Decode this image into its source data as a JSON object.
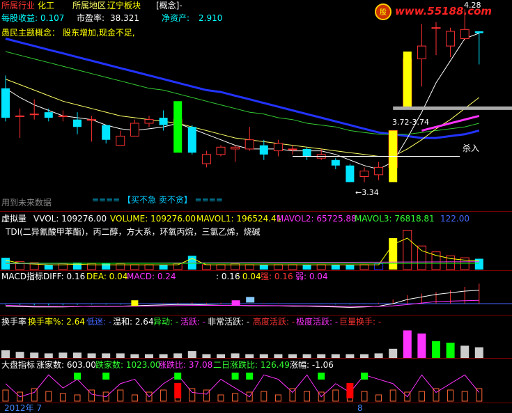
{
  "header": {
    "industry_label": "所属行业",
    "industry_value": "化工",
    "region_label": "所属地区",
    "region_value": "辽宁板块",
    "concept_label": "[概念]-",
    "eps_label": "每股收益:",
    "eps_value": "0.107",
    "pe_label": "市盈率:",
    "pe_value": "38.321",
    "nav_label": "净资产:",
    "nav_value": "2.910",
    "theme_label": "愚民主题概念：",
    "theme_value": "股东增加,现金不足,",
    "future_label": "用到未来数据",
    "advice": "==== 【买不急  卖不贪】 ===="
  },
  "watermark": {
    "site": "www.55188.com"
  },
  "colors": {
    "up": "#ff3232",
    "down": "#00e5ff",
    "ma5": "#ffffff",
    "ma10": "#ffff66",
    "ma20": "#33cc33",
    "ma60": "#2233ff",
    "magenta": "#ff33ff",
    "yellow": "#ffff00",
    "green": "#00ff00",
    "cyan": "#00e5ff",
    "red": "#ff0000",
    "gray": "#aaaaaa"
  },
  "price_panel": {
    "high_label": "4.28",
    "low_label": "←3.34",
    "zone_label": "3.72-3.74",
    "sell_label": "杀入"
  },
  "volume_panel": {
    "title": "虚拟量",
    "vvol": "VVOL: 109276.00",
    "volume": "VOLUME: 109276.00",
    "mavol1": "MAVOL1: 196524.41",
    "mavol2": "MAVOL2: 65725.88",
    "mavol3": "MAVOL3: 76818.81",
    "extra": "122.00",
    "concept": "TDI(二异氰酸甲苯酯)，丙二醇，方大系，环氧丙烷，三氯乙烯，烧碱"
  },
  "macd_panel": {
    "title": "MACD指标",
    "diff": "DIFF: 0.16",
    "dea": "DEA: 0.04",
    "macd": "MACD: 0.24",
    "v1": ": 0.16",
    "v2": ": 0.04",
    "strong": "强: 0.16",
    "weak": "弱: 0.04"
  },
  "turnover_panel": {
    "title": "换手率",
    "rate": "换手率%: 2.64",
    "low": "低迷: -",
    "mild": "温和: 2.64",
    "abnormal": "异动: -",
    "active": "活跃: -",
    "very_active": "非常活跃: -",
    "high_active": "高度活跃: -",
    "extreme_active": "极度活跃: -",
    "huge": "巨量换手: -"
  },
  "market_panel": {
    "title": "大盘指标",
    "up_count": "涨家数: 603.00",
    "down_count": "跌家数: 1023.00",
    "up_ratio": "涨跌比: 37.08",
    "two_day_ratio": "二日涨跌比: 126.49",
    "change": "涨幅: -1.06"
  },
  "xaxis": {
    "left_label": "2012年 7",
    "mid_label": "8"
  },
  "chart_data": {
    "type": "candlestick",
    "title": "",
    "candles": [
      {
        "o": 3.85,
        "c": 3.69,
        "h": 3.92,
        "l": 3.67
      },
      {
        "o": 3.7,
        "c": 3.7,
        "h": 3.74,
        "l": 3.58
      },
      {
        "o": 3.71,
        "c": 3.71,
        "h": 3.79,
        "l": 3.68
      },
      {
        "o": 3.72,
        "c": 3.69,
        "h": 3.74,
        "l": 3.67
      },
      {
        "o": 3.7,
        "c": 3.7,
        "h": 3.73,
        "l": 3.67
      },
      {
        "o": 3.68,
        "c": 3.64,
        "h": 3.72,
        "l": 3.6
      },
      {
        "o": 3.68,
        "c": 3.68,
        "h": 3.7,
        "l": 3.56
      },
      {
        "o": 3.65,
        "c": 3.57,
        "h": 3.65,
        "l": 3.55
      },
      {
        "o": 3.54,
        "c": 3.59,
        "h": 3.62,
        "l": 3.54
      },
      {
        "o": 3.59,
        "c": 3.66,
        "h": 3.68,
        "l": 3.59
      },
      {
        "o": 3.66,
        "c": 3.68,
        "h": 3.7,
        "l": 3.64
      },
      {
        "o": 3.69,
        "c": 3.65,
        "h": 3.73,
        "l": 3.62
      },
      {
        "o": 3.65,
        "c": 3.68,
        "h": 3.72,
        "l": 3.64
      },
      {
        "o": 3.64,
        "c": 3.5,
        "h": 3.65,
        "l": 3.49
      },
      {
        "o": 3.44,
        "c": 3.49,
        "h": 3.51,
        "l": 3.42
      },
      {
        "o": 3.49,
        "c": 3.53,
        "h": 3.54,
        "l": 3.48
      },
      {
        "o": 3.52,
        "c": 3.53,
        "h": 3.54,
        "l": 3.45
      },
      {
        "o": 3.52,
        "c": 3.57,
        "h": 3.64,
        "l": 3.51
      },
      {
        "o": 3.54,
        "c": 3.49,
        "h": 3.57,
        "l": 3.46
      },
      {
        "o": 3.51,
        "c": 3.55,
        "h": 3.57,
        "l": 3.48
      },
      {
        "o": 3.52,
        "c": 3.52,
        "h": 3.54,
        "l": 3.49
      },
      {
        "o": 3.52,
        "c": 3.48,
        "h": 3.53,
        "l": 3.46
      },
      {
        "o": 3.47,
        "c": 3.49,
        "h": 3.52,
        "l": 3.46
      },
      {
        "o": 3.46,
        "c": 3.43,
        "h": 3.47,
        "l": 3.41
      },
      {
        "o": 3.43,
        "c": 3.34,
        "h": 3.44,
        "l": 3.34
      },
      {
        "o": 3.37,
        "c": 3.4,
        "h": 3.42,
        "l": 3.34
      },
      {
        "o": 3.38,
        "c": 3.42,
        "h": 3.45,
        "l": 3.35
      },
      {
        "o": 3.42,
        "c": 3.62,
        "h": 3.62,
        "l": 3.38
      },
      {
        "o": 3.74,
        "c": 4.01,
        "h": 4.05,
        "l": 3.74
      },
      {
        "o": 4.01,
        "c": 4.08,
        "h": 4.2,
        "l": 3.86
      },
      {
        "o": 4.18,
        "c": 4.18,
        "h": 4.21,
        "l": 4.03
      },
      {
        "o": 4.08,
        "c": 4.16,
        "h": 4.18,
        "l": 4.02
      },
      {
        "o": 4.12,
        "c": 4.17,
        "h": 4.28,
        "l": 4.11
      },
      {
        "o": 4.16,
        "c": 4.15,
        "h": 4.16,
        "l": 3.98
      }
    ],
    "ma5": [
      3.85,
      3.8,
      3.76,
      3.73,
      3.7,
      3.69,
      3.68,
      3.65,
      3.63,
      3.62,
      3.63,
      3.64,
      3.66,
      3.63,
      3.6,
      3.57,
      3.54,
      3.52,
      3.52,
      3.52,
      3.51,
      3.51,
      3.51,
      3.49,
      3.46,
      3.43,
      3.41,
      3.45,
      3.58,
      3.72,
      3.88,
      4.0,
      4.12,
      4.15
    ],
    "ma10": [
      3.9,
      3.87,
      3.84,
      3.81,
      3.78,
      3.76,
      3.74,
      3.72,
      3.7,
      3.69,
      3.68,
      3.67,
      3.66,
      3.64,
      3.62,
      3.6,
      3.58,
      3.57,
      3.56,
      3.55,
      3.54,
      3.53,
      3.52,
      3.51,
      3.5,
      3.49,
      3.48,
      3.48,
      3.52,
      3.57,
      3.63,
      3.68,
      3.74,
      3.8
    ],
    "ma20": [
      4.05,
      4.03,
      4.01,
      3.99,
      3.97,
      3.95,
      3.93,
      3.91,
      3.89,
      3.87,
      3.85,
      3.84,
      3.82,
      3.8,
      3.78,
      3.76,
      3.74,
      3.72,
      3.71,
      3.69,
      3.68,
      3.66,
      3.65,
      3.64,
      3.62,
      3.61,
      3.6,
      3.6,
      3.6,
      3.61,
      3.62,
      3.63,
      3.64,
      3.66
    ],
    "ma60": [
      4.12,
      4.1,
      4.08,
      4.06,
      4.04,
      4.02,
      4.0,
      3.98,
      3.96,
      3.94,
      3.92,
      3.9,
      3.88,
      3.86,
      3.84,
      3.83,
      3.81,
      3.79,
      3.77,
      3.75,
      3.73,
      3.71,
      3.69,
      3.67,
      3.65,
      3.63,
      3.61,
      3.6,
      3.59,
      3.58,
      3.58,
      3.59,
      3.6,
      3.62
    ],
    "ylim": [
      3.3,
      4.3
    ],
    "volume": [
      60,
      40,
      35,
      25,
      30,
      35,
      30,
      30,
      30,
      25,
      25,
      25,
      30,
      70,
      25,
      25,
      30,
      25,
      25,
      25,
      25,
      25,
      25,
      25,
      25,
      25,
      30,
      160,
      200,
      120,
      90,
      70,
      60,
      55
    ],
    "vol_ylim": [
      0,
      220
    ],
    "macd_hist": [
      -0.01,
      -0.015,
      -0.02,
      -0.02,
      -0.02,
      -0.015,
      -0.01,
      -0.01,
      -0.01,
      -0.005,
      0,
      0.005,
      0.01,
      0.015,
      0.01,
      0.01,
      0.01,
      0.005,
      0.005,
      0.005,
      0,
      0,
      -0.005,
      -0.01,
      -0.01,
      -0.005,
      0.01,
      0.05,
      0.1,
      0.12,
      0.14,
      0.16,
      0.2,
      0.24
    ],
    "macd_diff": [
      -0.03,
      -0.035,
      -0.04,
      -0.04,
      -0.04,
      -0.035,
      -0.03,
      -0.03,
      -0.03,
      -0.025,
      -0.02,
      -0.015,
      -0.01,
      -0.01,
      -0.015,
      -0.02,
      -0.02,
      -0.025,
      -0.025,
      -0.025,
      -0.03,
      -0.03,
      -0.035,
      -0.04,
      -0.045,
      -0.04,
      -0.03,
      0.0,
      0.05,
      0.08,
      0.11,
      0.13,
      0.15,
      0.16
    ],
    "macd_dea": [
      -0.02,
      -0.025,
      -0.03,
      -0.032,
      -0.034,
      -0.034,
      -0.033,
      -0.032,
      -0.031,
      -0.03,
      -0.028,
      -0.026,
      -0.024,
      -0.022,
      -0.021,
      -0.021,
      -0.021,
      -0.022,
      -0.023,
      -0.024,
      -0.025,
      -0.026,
      -0.027,
      -0.029,
      -0.031,
      -0.033,
      -0.032,
      -0.026,
      -0.011,
      0.007,
      0.025,
      0.03,
      0.035,
      0.04
    ],
    "turnover": [
      1.0,
      0.8,
      0.7,
      0.6,
      0.7,
      0.7,
      0.6,
      0.6,
      0.6,
      0.5,
      0.5,
      0.5,
      0.6,
      0.9,
      0.5,
      0.5,
      0.6,
      0.5,
      0.5,
      0.5,
      0.5,
      0.5,
      0.5,
      0.5,
      0.5,
      0.5,
      0.6,
      1.2,
      3.6,
      3.2,
      2.2,
      2.0,
      1.6,
      1.4
    ],
    "turnover_ylim": [
      0,
      4
    ],
    "market_updown": [
      20,
      5,
      10,
      30,
      15,
      25,
      8,
      5,
      20,
      25,
      5,
      20,
      30,
      10,
      8,
      25,
      15,
      5,
      30,
      25,
      10,
      30,
      5,
      20,
      10,
      30,
      25,
      20,
      5,
      30,
      10,
      20,
      30,
      10
    ]
  }
}
